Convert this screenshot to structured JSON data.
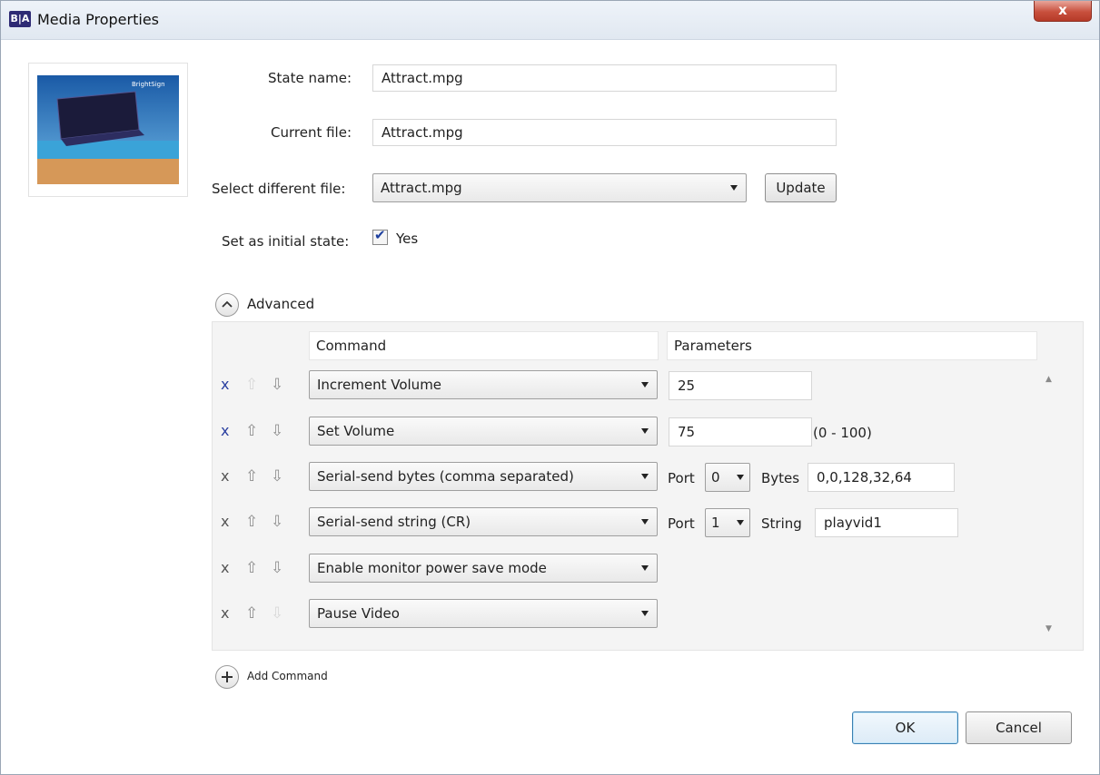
{
  "window": {
    "title": "Media Properties",
    "app_icon_text": "B|A",
    "close_label": "x"
  },
  "form": {
    "state_name_label": "State name:",
    "state_name_value": "Attract.mpg",
    "current_file_label": "Current file:",
    "current_file_value": "Attract.mpg",
    "select_file_label": "Select different file:",
    "select_file_value": "Attract.mpg",
    "update_label": "Update",
    "initial_state_label": "Set as initial state:",
    "initial_state_checked": true,
    "initial_state_option": "Yes"
  },
  "advanced": {
    "label": "Advanced",
    "header_command": "Command",
    "header_parameters": "Parameters",
    "rows": [
      {
        "remove": "x",
        "command": "Increment Volume",
        "param": "25"
      },
      {
        "remove": "x",
        "command": "Set Volume",
        "param": "75",
        "hint": "(0 - 100)"
      },
      {
        "remove": "x",
        "command": "Serial-send bytes (comma separated)",
        "port_label": "Port",
        "port": "0",
        "value_label": "Bytes",
        "value": "0,0,128,32,64"
      },
      {
        "remove": "x",
        "command": "Serial-send string (CR)",
        "port_label": "Port",
        "port": "1",
        "value_label": "String",
        "value": "playvid1"
      },
      {
        "remove": "x",
        "command": "Enable monitor power save mode"
      },
      {
        "remove": "x",
        "command": "Pause Video"
      }
    ]
  },
  "add_command_label": "Add Command",
  "ok_label": "OK",
  "cancel_label": "Cancel",
  "thumbnail": {
    "logo_text": "BrightSign",
    "sky_color": "#2c80c8",
    "sand_color": "#d69858",
    "sea_color": "#3aa3d8"
  }
}
